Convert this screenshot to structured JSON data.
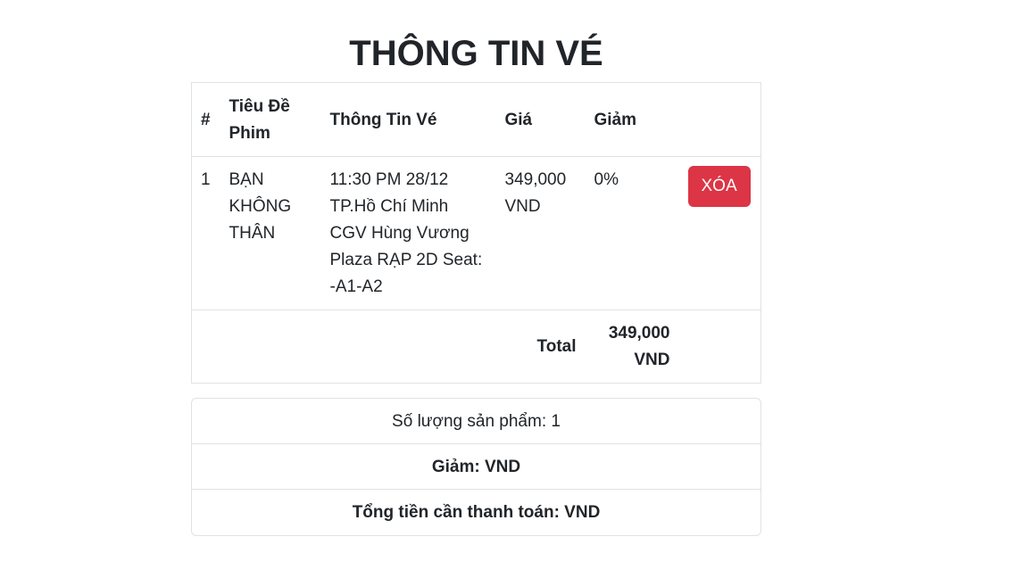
{
  "page": {
    "title": "THÔNG TIN VÉ"
  },
  "table": {
    "headers": [
      "#",
      "Tiêu Đề Phim",
      "Thông Tin Vé",
      "Giá",
      "Giảm",
      ""
    ],
    "rows": [
      {
        "index": "1",
        "title": "BẠN KHÔNG THÂN",
        "info": "11:30 PM 28/12 TP.Hồ Chí Minh CGV Hùng Vương Plaza RẠP 2D Seat: -A1-A2",
        "price": "349,000 VND",
        "discount": "0%",
        "delete_label": "XÓA"
      }
    ],
    "total_label": "Total",
    "total_value": "349,000 VND"
  },
  "summary": {
    "quantity": "Số lượng sản phẩm: 1",
    "discount": "Giảm: VND",
    "grand_total": "Tổng tiền cần thanh toán: VND"
  },
  "colors": {
    "danger": "#dc3545",
    "border": "#dee2e6",
    "text": "#212529"
  }
}
